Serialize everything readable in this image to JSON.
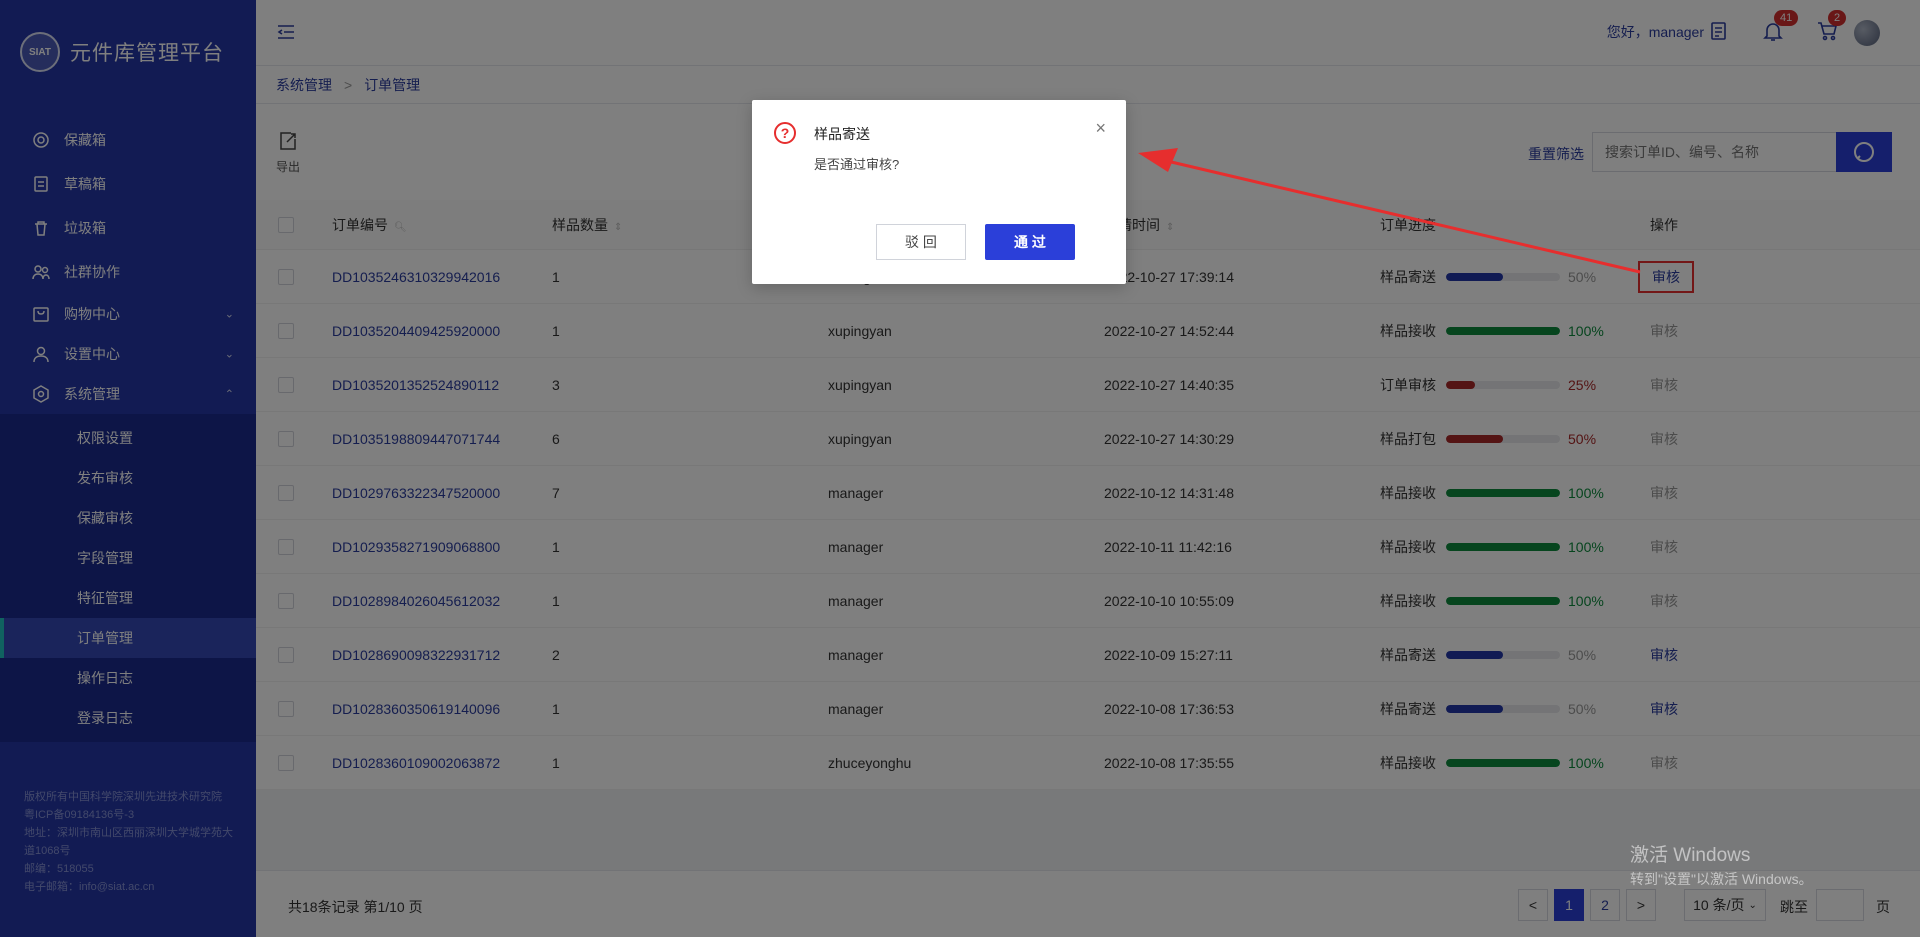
{
  "app": {
    "title": "元件库管理平台",
    "logo_text": "SIAT"
  },
  "sidebar": {
    "items": [
      {
        "label": "保藏箱",
        "icon": "safe-icon"
      },
      {
        "label": "草稿箱",
        "icon": "draft-icon"
      },
      {
        "label": "垃圾箱",
        "icon": "trash-icon"
      },
      {
        "label": "社群协作",
        "icon": "community-icon"
      },
      {
        "label": "购物中心",
        "icon": "shop-icon"
      },
      {
        "label": "设置中心",
        "icon": "user-settings-icon"
      },
      {
        "label": "系统管理",
        "icon": "system-gear-icon"
      }
    ],
    "submenu": [
      "权限设置",
      "发布审核",
      "保藏审核",
      "字段管理",
      "特征管理",
      "订单管理",
      "操作日志",
      "登录日志"
    ],
    "footer": [
      "版权所有中国科学院深圳先进技术研究院 粤ICP备09184136号-3",
      "地址：深圳市南山区西丽深圳大学城学苑大道1068号",
      "邮编：518055",
      "电子邮箱：info@siat.ac.cn"
    ]
  },
  "header": {
    "greeting": "您好，manager",
    "notification_count": "41",
    "cart_count": "2"
  },
  "breadcrumb": {
    "parent": "系统管理",
    "separator": ">",
    "current": "订单管理"
  },
  "toolbar": {
    "export_label": "导出",
    "reset_label": "重置筛选",
    "search_placeholder": "搜索订单ID、编号、名称"
  },
  "table": {
    "headers": {
      "order_id": "订单编号",
      "qty": "样品数量",
      "time": "申请时间",
      "progress": "订单进度",
      "action": "操作"
    },
    "rows": [
      {
        "id": "DD1035246310329942016",
        "qty": "1",
        "user": "manager",
        "time": "2022-10-27 17:39:14",
        "stage": "样品寄送",
        "pct": "50%",
        "action": "审核"
      },
      {
        "id": "DD1035204409425920000",
        "qty": "1",
        "user": "xupingyan",
        "time": "2022-10-27 14:52:44",
        "stage": "样品接收",
        "pct": "100%",
        "action": "审核"
      },
      {
        "id": "DD1035201352524890112",
        "qty": "3",
        "user": "xupingyan",
        "time": "2022-10-27 14:40:35",
        "stage": "订单审核",
        "pct": "25%",
        "action": "审核"
      },
      {
        "id": "DD1035198809447071744",
        "qty": "6",
        "user": "xupingyan",
        "time": "2022-10-27 14:30:29",
        "stage": "样品打包",
        "pct": "50%",
        "action": "审核"
      },
      {
        "id": "DD1029763322347520000",
        "qty": "7",
        "user": "manager",
        "time": "2022-10-12 14:31:48",
        "stage": "样品接收",
        "pct": "100%",
        "action": "审核"
      },
      {
        "id": "DD1029358271909068800",
        "qty": "1",
        "user": "manager",
        "time": "2022-10-11 11:42:16",
        "stage": "样品接收",
        "pct": "100%",
        "action": "审核"
      },
      {
        "id": "DD1028984026045612032",
        "qty": "1",
        "user": "manager",
        "time": "2022-10-10 10:55:09",
        "stage": "样品接收",
        "pct": "100%",
        "action": "审核"
      },
      {
        "id": "DD1028690098322931712",
        "qty": "2",
        "user": "manager",
        "time": "2022-10-09 15:27:11",
        "stage": "样品寄送",
        "pct": "50%",
        "action": "审核"
      },
      {
        "id": "DD1028360350619140096",
        "qty": "1",
        "user": "manager",
        "time": "2022-10-08 17:36:53",
        "stage": "样品寄送",
        "pct": "50%",
        "action": "审核"
      },
      {
        "id": "DD1028360109002063872",
        "qty": "1",
        "user": "zhuceyonghu",
        "time": "2022-10-08 17:35:55",
        "stage": "样品接收",
        "pct": "100%",
        "action": "审核"
      }
    ]
  },
  "pagination": {
    "summary": "共18条记录 第1/10 页",
    "prev": "<",
    "page1": "1",
    "page2": "2",
    "next": ">",
    "page_size": "10 条/页",
    "jump_label": "跳至",
    "page_suffix": "页"
  },
  "modal": {
    "title": "样品寄送",
    "message": "是否通过审核?",
    "reject_label": "驳 回",
    "pass_label": "通 过",
    "close": "×"
  },
  "watermark": {
    "line1": "激活 Windows",
    "line2": "转到\"设置\"以激活 Windows。"
  },
  "colors": {
    "primary": "#2b3fd9",
    "sidebar": "#2436a6",
    "progress_blue": "#2337a8",
    "progress_green": "#0c8a3c",
    "progress_red": "#a82828",
    "annotation_red": "#e62e2e"
  }
}
